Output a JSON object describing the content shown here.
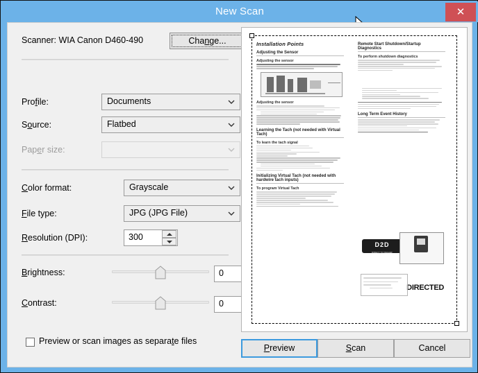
{
  "window": {
    "title": "New Scan",
    "close_label": "✕",
    "accent_blue": "#6cb2e8",
    "close_red": "#cf5055"
  },
  "scanner": {
    "label": "Scanner: WIA Canon D460-490",
    "change_button": "Change..."
  },
  "fields": [
    {
      "label": "Profile:",
      "value": "Documents",
      "disabled": false
    },
    {
      "label": "Source:",
      "value": "Flatbed",
      "disabled": false
    },
    {
      "label": "Paper size:",
      "value": "",
      "disabled": true
    },
    {
      "label": "Color format:",
      "value": "Grayscale",
      "disabled": false
    },
    {
      "label": "File type:",
      "value": "JPG (JPG File)",
      "disabled": false
    },
    {
      "label": "Resolution (DPI):",
      "value": "300",
      "disabled": false
    }
  ],
  "sliders": [
    {
      "label": "Brightness:",
      "value": "0"
    },
    {
      "label": "Contrast:",
      "value": "0"
    }
  ],
  "checkbox": {
    "label": "Preview or scan images as separate files",
    "checked": false
  },
  "buttons": {
    "preview": "Preview",
    "scan": "Scan",
    "cancel": "Cancel"
  },
  "preview_document": {
    "left_column": {
      "title": "Installation Points",
      "section1": "Adjusting the Sensor",
      "sub1": "Adjusting the sensor",
      "section2": "Learning the Tach (not needed with Virtual Tach)",
      "sub2": "To learn the tach signal",
      "section3": "Initializing Virtual Tach (not needed with hardwire tach inputs)",
      "sub3": "To program Virtual Tach"
    },
    "right_column": {
      "title": "Remote Start Shutdown/Startup Diagnostics",
      "sub1": "To perform shutdown diagnostics",
      "table_header_1": "Status LED Flashes",
      "table_header_2": "Shutdown Mode",
      "section2": "Long Term Event History",
      "brand_logo": "DIRECTED",
      "secondary_logo": "D2D",
      "secondary_logo_sub": "DIRECT TO DEALER"
    }
  }
}
